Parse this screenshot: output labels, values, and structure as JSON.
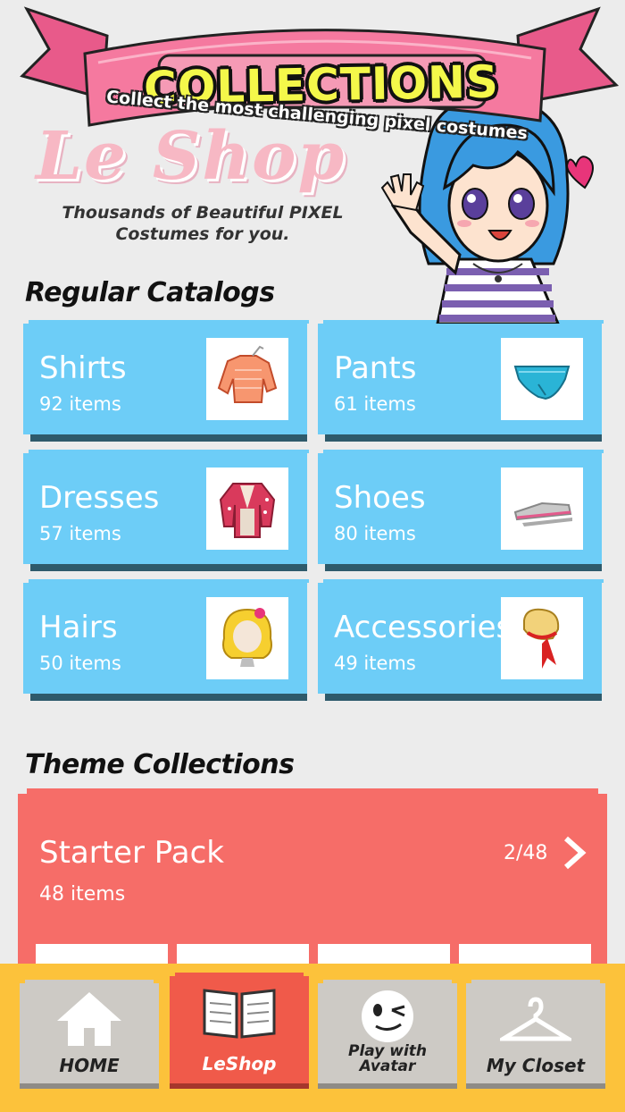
{
  "banner": {
    "title": "COLLECTIONS",
    "subtitle": "Collect the most challenging pixel costumes"
  },
  "header": {
    "logo_text": "Le Shop",
    "tagline_line1": "Thousands of Beautiful PIXEL",
    "tagline_line2": "Costumes for you."
  },
  "regular": {
    "title": "Regular Catalogs",
    "items": [
      {
        "name": "Shirts",
        "count": "92 items",
        "icon": "shirt-icon"
      },
      {
        "name": "Pants",
        "count": "61 items",
        "icon": "pants-icon"
      },
      {
        "name": "Dresses",
        "count": "57 items",
        "icon": "jacket-icon"
      },
      {
        "name": "Shoes",
        "count": "80 items",
        "icon": "sneaker-icon"
      },
      {
        "name": "Hairs",
        "count": "50 items",
        "icon": "wig-icon"
      },
      {
        "name": "Accessories",
        "count": "49 items",
        "icon": "hat-icon"
      }
    ]
  },
  "theme": {
    "title": "Theme Collections",
    "items": [
      {
        "name": "Starter Pack",
        "count": "48 items",
        "progress": "2/48"
      }
    ]
  },
  "nav": {
    "items": [
      {
        "label": "HOME",
        "icon": "home-icon"
      },
      {
        "label": "LeShop",
        "icon": "book-icon"
      },
      {
        "label_line1": "Play with",
        "label_line2": "Avatar",
        "icon": "wink-face-icon"
      },
      {
        "label": "My Closet",
        "icon": "hanger-icon"
      }
    ],
    "active_index": 1
  },
  "colors": {
    "catalog_card": "#6dcdf7",
    "theme_card": "#f66d68",
    "nav_bar": "#fcc23b",
    "nav_active": "#f05a4a",
    "banner_title": "#f4f84a"
  }
}
